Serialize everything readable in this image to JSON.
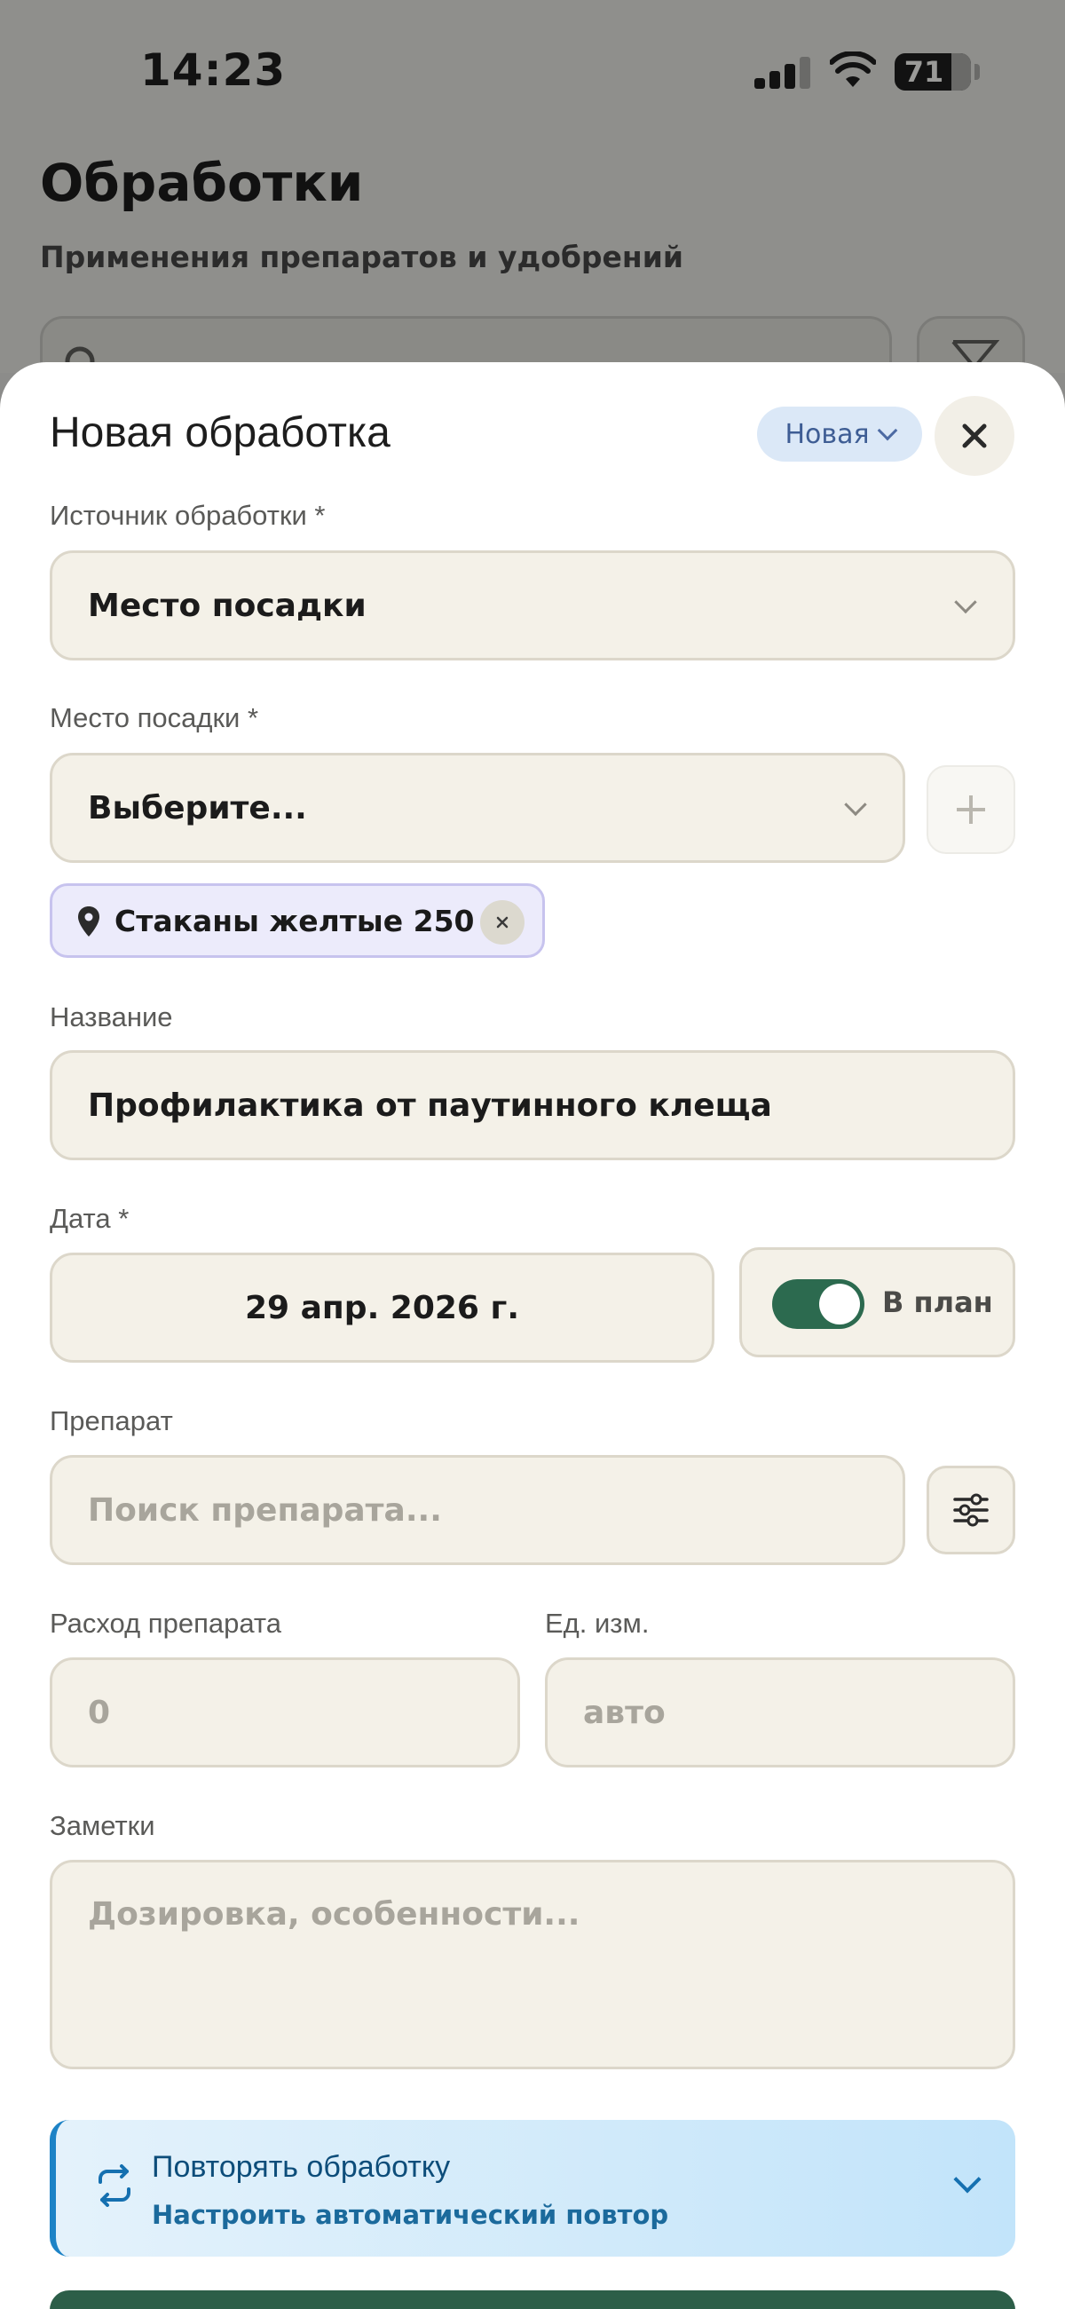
{
  "status_bar": {
    "time": "14:23",
    "battery": "71"
  },
  "background": {
    "title": "Обработки",
    "subtitle": "Применения препаратов и удобрений"
  },
  "sheet": {
    "title": "Новая обработка",
    "status_chip": "Новая",
    "source": {
      "label": "Источник обработки *",
      "value": "Место посадки"
    },
    "location": {
      "label": "Место посадки *",
      "placeholder": "Выберите...",
      "selected_tag": "Стаканы желтые 250 ..."
    },
    "name": {
      "label": "Название",
      "value": "Профилактика от паутинного клеща"
    },
    "date": {
      "label": "Дата *",
      "value": "29 апр. 2026 г.",
      "plan_toggle_label": "В план",
      "plan_toggle_on": true
    },
    "product": {
      "label": "Препарат",
      "placeholder": "Поиск препарата..."
    },
    "consumption": {
      "label": "Расход препарата",
      "placeholder": "0"
    },
    "unit": {
      "label": "Ед. изм.",
      "placeholder": "авто"
    },
    "notes": {
      "label": "Заметки",
      "placeholder": "Дозировка, особенности..."
    },
    "repeat": {
      "title": "Повторять обработку",
      "subtitle": "Настроить автоматический повтор"
    }
  },
  "colors": {
    "accent_green": "#2c6a4f",
    "field_bg": "#f4f1e8",
    "chip_blue": "#dbe8f7",
    "repeat_blue": "#1d83c6"
  }
}
